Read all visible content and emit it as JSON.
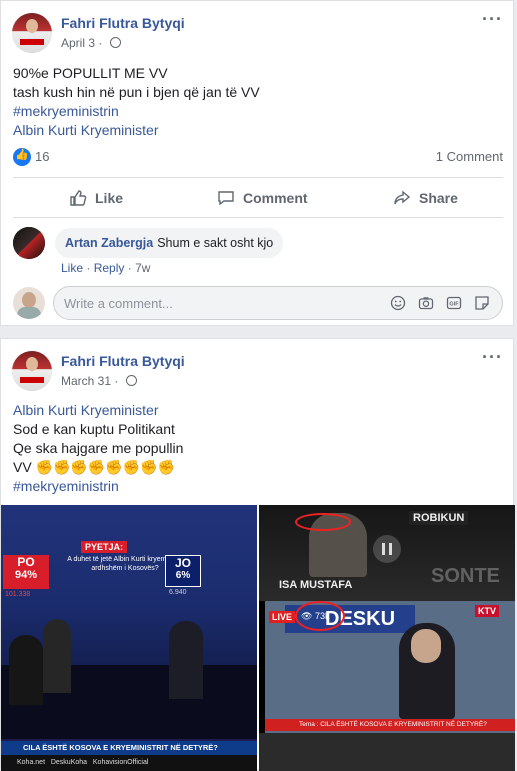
{
  "post1": {
    "author": "Fahri Flutra Bytyqi",
    "date": "April 3 · ",
    "lines": [
      "90%e POPULLIT ME VV",
      "tash kush hin në pun i bjen që jan të VV"
    ],
    "hashtag": "#mekryeministrin",
    "link": "Albin Kurti Kryeminister",
    "likes": "16",
    "comments": "1 Comment",
    "actions": {
      "like": "Like",
      "comment": "Comment",
      "share": "Share"
    },
    "comment": {
      "author": "Artan Zabergja",
      "text": "Shum e sakt osht kjo",
      "like": "Like",
      "reply": "Reply",
      "time": "7w"
    },
    "write_placeholder": "Write a comment..."
  },
  "post2": {
    "author": "Fahri Flutra Bytyqi",
    "date": "March 31 · ",
    "link": "Albin Kurti Kryeminister",
    "lines": [
      "Sod e kan kuptu Politikant",
      "Qe ska hajgare me popullin",
      "VV ✊✊✊✊✊✊✊✊"
    ],
    "hashtag": "#mekryeministrin",
    "media_left": {
      "pyetja": "PYETJA:",
      "question": "A duhet të jetë Albin Kurti kryeministri ardhshëm i Kosovës?",
      "po": "PO",
      "po_pct": "94%",
      "po_votes": "101.338",
      "jo": "JO",
      "jo_pct": "6%",
      "jo_votes": "6.940",
      "ticker": "CILA ËSHTË KOSOVA E KRYEMINISTRIT NË DETYRË?",
      "footer": "Koha.net   DeskuKoha   KohavisionOfficial"
    },
    "media_right": {
      "brand": "ROBIKUN",
      "caption": "ISA MUSTAFA",
      "sonte": "SONTE",
      "desku": "DESKU",
      "live": "LIVE",
      "views": "73k",
      "ktv": "KTV",
      "ticker": "Tema : CILA ËSHTË KOSOVA E KRYEMINISTRIT NË DETYRË?"
    }
  },
  "colors": {
    "link": "#385898",
    "meta": "#606770",
    "accent": "#1877f2"
  }
}
